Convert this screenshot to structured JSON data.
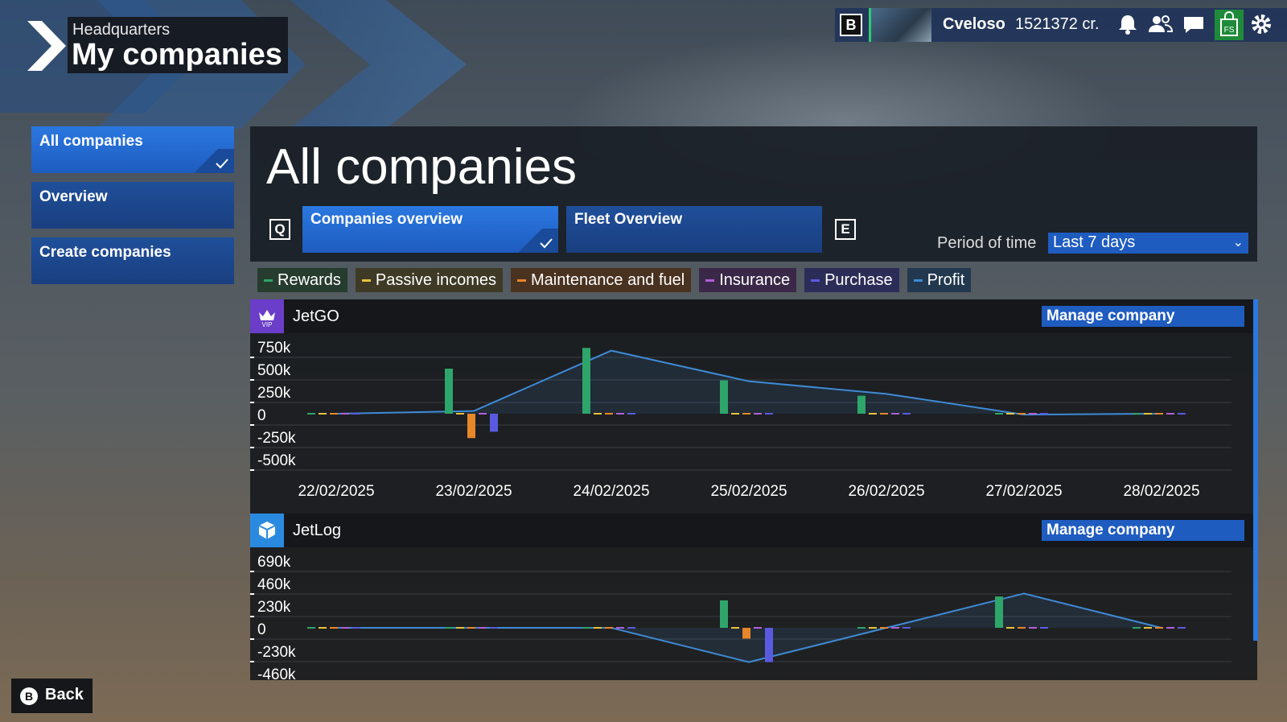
{
  "header": {
    "subtitle": "Headquarters",
    "title": "My companies"
  },
  "topbar": {
    "key_hint": "B",
    "username": "Cveloso",
    "credits": "1521372 cr.",
    "icons": [
      "bell-icon",
      "friends-icon",
      "chat-icon",
      "store-icon",
      "gear-icon"
    ]
  },
  "sidebar": {
    "items": [
      {
        "label": "All companies",
        "active": true
      },
      {
        "label": "Overview",
        "active": false
      },
      {
        "label": "Create companies",
        "active": false
      }
    ]
  },
  "main": {
    "title": "All companies",
    "key_left": "Q",
    "key_right": "E",
    "tabs": [
      {
        "label": "Companies overview",
        "active": true
      },
      {
        "label": "Fleet Overview",
        "active": false
      }
    ],
    "period_label": "Period of time",
    "period_value": "Last 7 days"
  },
  "legend": [
    {
      "label": "Rewards",
      "color": "#2ea56a",
      "bg": "#263c2e"
    },
    {
      "label": "Passive incomes",
      "color": "#e8c23a",
      "bg": "#3e3a26"
    },
    {
      "label": "Maintenance and fuel",
      "color": "#e8862a",
      "bg": "#4a3220"
    },
    {
      "label": "Insurance",
      "color": "#b25fd6",
      "bg": "#3a2848"
    },
    {
      "label": "Purchase",
      "color": "#5a5ae0",
      "bg": "#2c2c58"
    },
    {
      "label": "Profit",
      "color": "#3e8ad6",
      "bg": "#22384e"
    }
  ],
  "companies": [
    {
      "name": "JetGO",
      "manage_label": "Manage company",
      "icon": "vip-crown-icon",
      "icon_bg": "#6a3ec8"
    },
    {
      "name": "JetLog",
      "manage_label": "Manage company",
      "icon": "cargo-box-icon",
      "icon_bg": "#2a8ae0"
    }
  ],
  "chart_data": [
    {
      "type": "bar",
      "company": "JetGO",
      "categories": [
        "22/02/2025",
        "23/02/2025",
        "24/02/2025",
        "25/02/2025",
        "26/02/2025",
        "27/02/2025",
        "28/02/2025"
      ],
      "y_ticks": [
        "750k",
        "500k",
        "250k",
        "0",
        "-250k",
        "-500k"
      ],
      "ylim": [
        -500000,
        750000
      ],
      "series": [
        {
          "name": "Rewards",
          "values": [
            0,
            500000,
            730000,
            370000,
            200000,
            0,
            0
          ]
        },
        {
          "name": "Passive incomes",
          "values": [
            0,
            0,
            0,
            0,
            0,
            0,
            0
          ]
        },
        {
          "name": "Maintenance and fuel",
          "values": [
            0,
            -270000,
            0,
            0,
            0,
            0,
            0
          ]
        },
        {
          "name": "Insurance",
          "values": [
            0,
            0,
            0,
            0,
            0,
            0,
            0
          ]
        },
        {
          "name": "Purchase",
          "values": [
            0,
            -200000,
            0,
            0,
            0,
            0,
            0
          ]
        },
        {
          "name": "Profit",
          "values": [
            0,
            30000,
            700000,
            360000,
            220000,
            -10000,
            0
          ]
        }
      ]
    },
    {
      "type": "bar",
      "company": "JetLog",
      "categories": [
        "22/02/2025",
        "23/02/2025",
        "24/02/2025",
        "25/02/2025",
        "26/02/2025",
        "27/02/2025",
        "28/02/2025"
      ],
      "y_ticks": [
        "690k",
        "460k",
        "230k",
        "0",
        "-230k",
        "-460k"
      ],
      "ylim": [
        -460000,
        690000
      ],
      "series": [
        {
          "name": "Rewards",
          "values": [
            0,
            0,
            0,
            280000,
            0,
            320000,
            0
          ]
        },
        {
          "name": "Passive incomes",
          "values": [
            0,
            0,
            0,
            0,
            0,
            0,
            0
          ]
        },
        {
          "name": "Maintenance and fuel",
          "values": [
            0,
            0,
            0,
            -110000,
            0,
            0,
            0
          ]
        },
        {
          "name": "Insurance",
          "values": [
            0,
            0,
            0,
            0,
            0,
            0,
            0
          ]
        },
        {
          "name": "Purchase",
          "values": [
            0,
            0,
            0,
            -350000,
            0,
            0,
            0
          ]
        },
        {
          "name": "Profit",
          "values": [
            0,
            0,
            0,
            -350000,
            0,
            350000,
            0
          ]
        }
      ]
    }
  ]
}
